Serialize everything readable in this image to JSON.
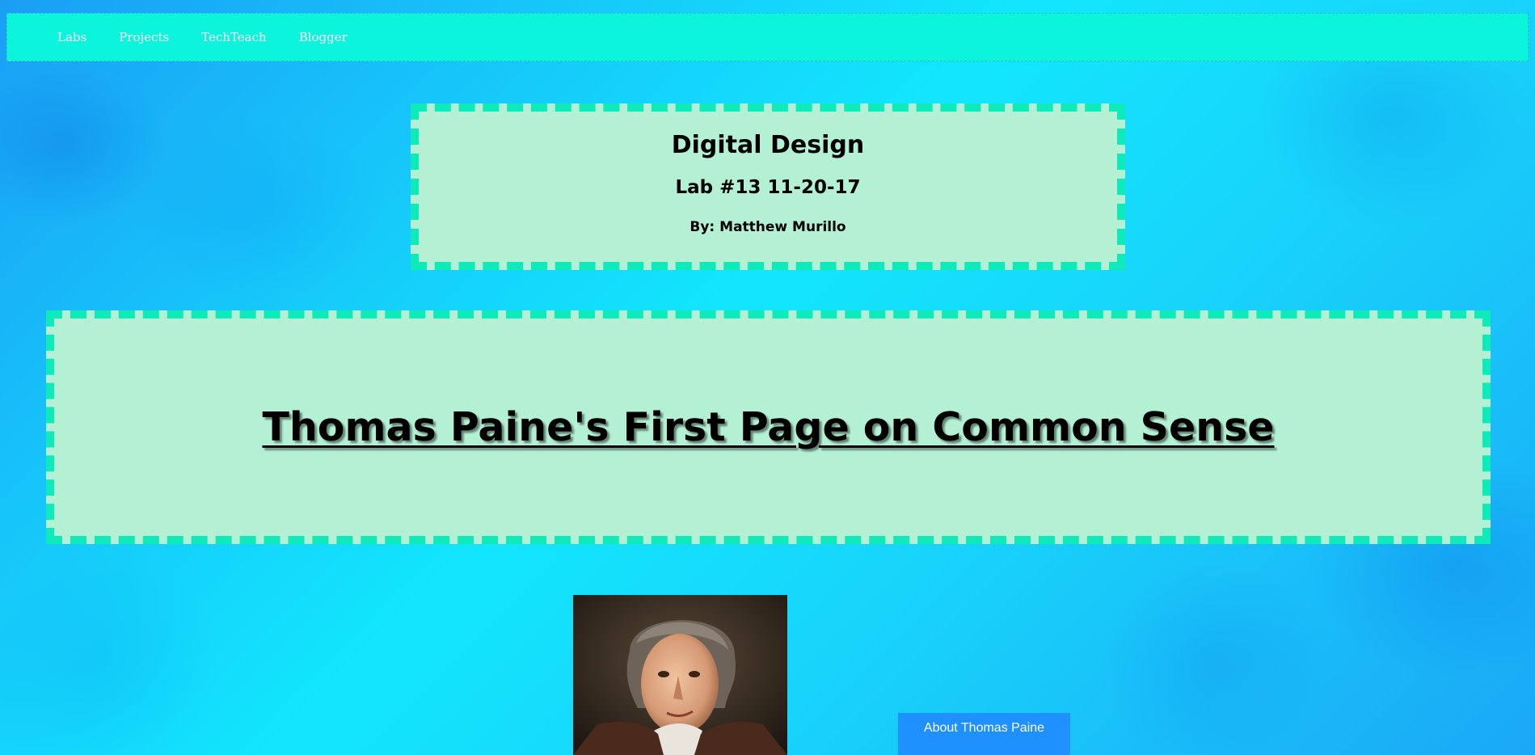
{
  "nav": {
    "items": [
      {
        "label": "Labs"
      },
      {
        "label": "Projects"
      },
      {
        "label": "TechTeach"
      },
      {
        "label": "Blogger"
      }
    ]
  },
  "header": {
    "title": "Digital Design",
    "lab": "Lab #13 11-20-17",
    "author": "By: Matthew Murillo"
  },
  "banner": {
    "title": "Thomas Paine's First Page on Common Sense"
  },
  "portrait": {
    "icon": "thomas-paine-portrait"
  },
  "about_button": {
    "label": "About Thomas Paine"
  },
  "colors": {
    "navbar": "#0cf5dc",
    "box_fill": "#b3f0d4",
    "box_border": "#0eeab9",
    "button": "#1e90ff"
  }
}
